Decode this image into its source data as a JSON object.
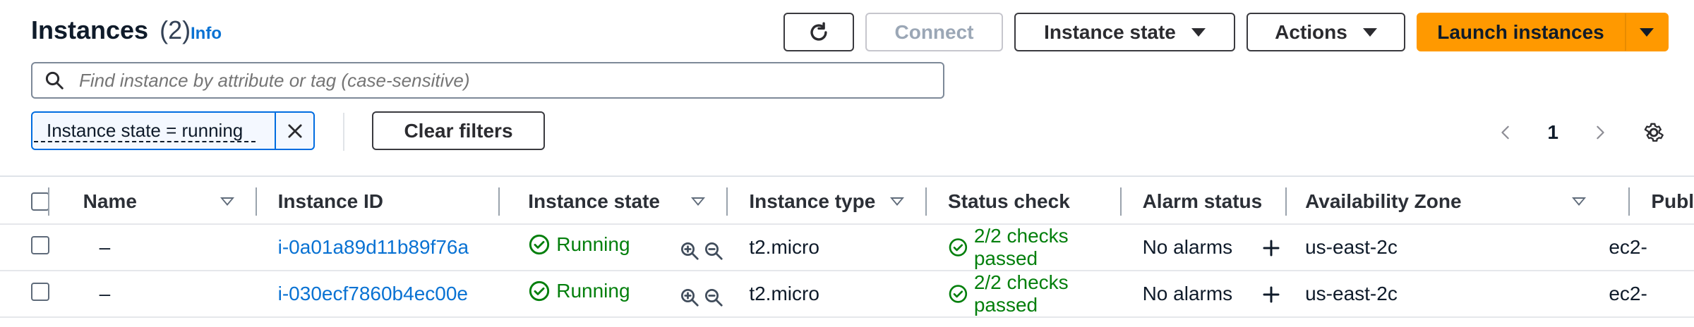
{
  "header": {
    "title": "Instances",
    "count": "(2)",
    "info": "Info"
  },
  "toolbar": {
    "refresh_icon": "refresh-icon",
    "connect": "Connect",
    "instance_state": "Instance state",
    "actions": "Actions",
    "launch": "Launch instances"
  },
  "search": {
    "placeholder": "Find instance by attribute or tag (case-sensitive)"
  },
  "filters": {
    "chip": "Instance state = running",
    "clear": "Clear filters"
  },
  "pagination": {
    "page": "1"
  },
  "table": {
    "columns": [
      "Name",
      "Instance ID",
      "Instance state",
      "Instance type",
      "Status check",
      "Alarm status",
      "Availability Zone",
      "Publ"
    ],
    "rows": [
      {
        "name": "–",
        "id": "i-0a01a89d11b89f76a",
        "state": "Running",
        "type": "t2.micro",
        "status": "2/2 checks passed",
        "alarm": "No alarms",
        "az": "us-east-2c",
        "public": "ec2-"
      },
      {
        "name": "–",
        "id": "i-030ecf7860b4ec00e",
        "state": "Running",
        "type": "t2.micro",
        "status": "2/2 checks passed",
        "alarm": "No alarms",
        "az": "us-east-2c",
        "public": "ec2-"
      }
    ]
  },
  "colors": {
    "accent": "#ff9900",
    "link": "#0972d3",
    "success": "#037f0c"
  }
}
